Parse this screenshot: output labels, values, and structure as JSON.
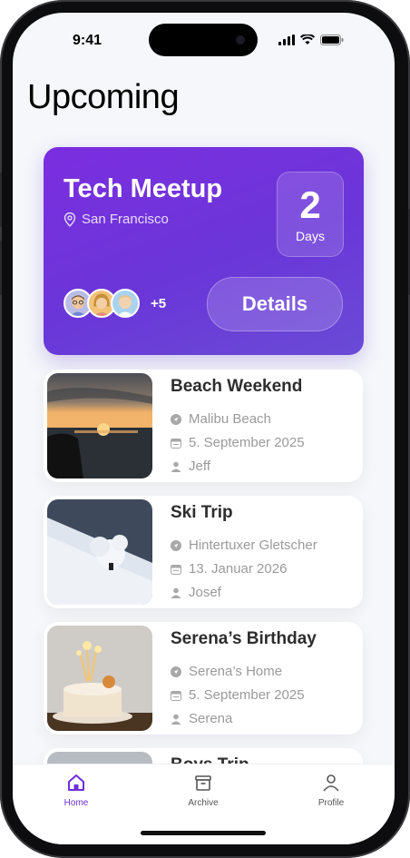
{
  "status_bar": {
    "time": "9:41"
  },
  "page": {
    "title": "Upcoming"
  },
  "featured": {
    "title": "Tech Meetup",
    "location": "San Francisco",
    "days_count": "2",
    "days_label": "Days",
    "extra_attendees": "+5",
    "details_label": "Details"
  },
  "events": [
    {
      "title": "Beach Weekend",
      "location": "Malibu Beach",
      "date": "5. September 2025",
      "person": "Jeff"
    },
    {
      "title": "Ski Trip",
      "location": "Hintertuxer Gletscher",
      "date": "13. Januar 2026",
      "person": "Josef"
    },
    {
      "title": "Serena’s Birthday",
      "location": "Serena’s Home",
      "date": "5. September 2025",
      "person": "Serena"
    },
    {
      "title": "Boys Trip"
    }
  ],
  "tabs": [
    {
      "label": "Home",
      "icon": "home-icon",
      "active": true
    },
    {
      "label": "Archive",
      "icon": "archive-icon",
      "active": false
    },
    {
      "label": "Profile",
      "icon": "profile-icon",
      "active": false
    }
  ],
  "colors": {
    "accent": "#6b2fd9",
    "card_gradient_start": "#7c2ee0",
    "card_gradient_end": "#6a4bd6",
    "meta_text": "#9a9a9a"
  }
}
